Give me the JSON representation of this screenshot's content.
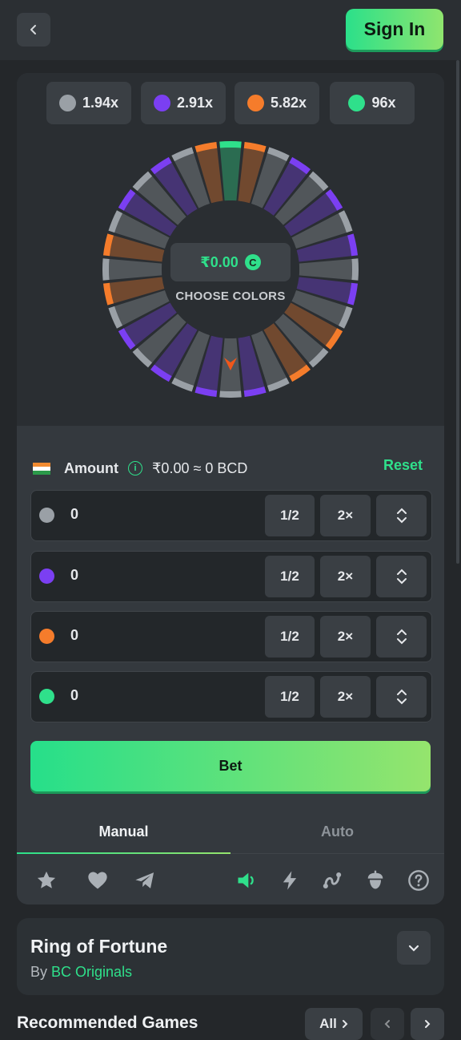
{
  "header": {
    "back_icon": "chevron-left-icon",
    "signin_label": "Sign In"
  },
  "multipliers": [
    {
      "label": "1.94x",
      "color": "#9aa0a6"
    },
    {
      "label": "2.91x",
      "color": "#7b3ff2"
    },
    {
      "label": "5.82x",
      "color": "#f57c2b"
    },
    {
      "label": "96x",
      "color": "#2fe08b"
    }
  ],
  "wheel": {
    "center_amount": "₹0.00",
    "coin_symbol": "C",
    "prompt": "CHOOSE COLORS",
    "segment_colors": [
      "#2fe08b",
      "#f57c2b",
      "#9aa0a6",
      "#7b3ff2",
      "#9aa0a6",
      "#7b3ff2",
      "#9aa0a6",
      "#7b3ff2",
      "#9aa0a6",
      "#7b3ff2",
      "#9aa0a6",
      "#f57c2b",
      "#9aa0a6",
      "#f57c2b",
      "#9aa0a6",
      "#7b3ff2",
      "#9aa0a6",
      "#7b3ff2",
      "#9aa0a6",
      "#7b3ff2",
      "#9aa0a6",
      "#7b3ff2",
      "#9aa0a6",
      "#f57c2b",
      "#9aa0a6",
      "#f57c2b",
      "#9aa0a6",
      "#7b3ff2",
      "#9aa0a6",
      "#7b3ff2",
      "#9aa0a6",
      "#f57c2b"
    ]
  },
  "amount": {
    "label": "Amount",
    "value": "₹0.00 ≈ 0 BCD",
    "reset_label": "Reset"
  },
  "bet_rows": [
    {
      "color": "#9aa0a6",
      "value": "0",
      "half_label": "1/2",
      "double_label": "2×"
    },
    {
      "color": "#7b3ff2",
      "value": "0",
      "half_label": "1/2",
      "double_label": "2×"
    },
    {
      "color": "#f57c2b",
      "value": "0",
      "half_label": "1/2",
      "double_label": "2×"
    },
    {
      "color": "#2fe08b",
      "value": "0",
      "half_label": "1/2",
      "double_label": "2×"
    }
  ],
  "bet_button_label": "Bet",
  "tabs": [
    {
      "label": "Manual",
      "active": true
    },
    {
      "label": "Auto",
      "active": false
    }
  ],
  "toolbar_icons": [
    "star-icon",
    "heart-icon",
    "telegram-icon",
    "sound-icon",
    "lightning-icon",
    "chart-curve-icon",
    "acorn-icon",
    "help-icon"
  ],
  "game_info": {
    "title": "Ring of Fortune",
    "by_prefix": "By",
    "studio": "BC Originals"
  },
  "recommended": {
    "title": "Recommended Games",
    "all_label": "All"
  },
  "colors": {
    "accent": "#2fe08b",
    "background": "#24272a",
    "panel": "#2c3135"
  }
}
